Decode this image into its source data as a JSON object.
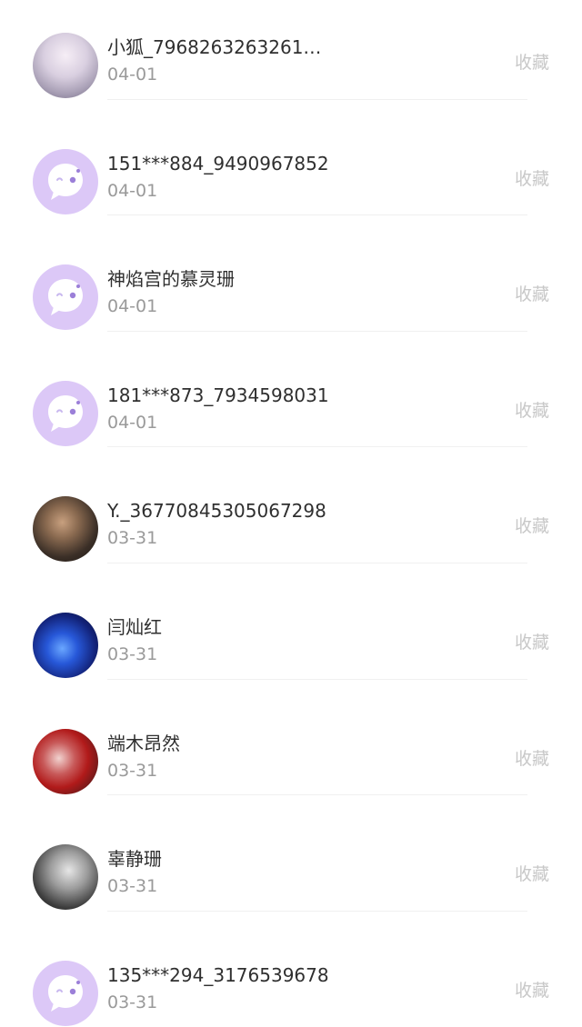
{
  "items": [
    {
      "name": "小狐_7968263263261…",
      "date": "04-01",
      "action": "收藏",
      "avatar": "photo-1"
    },
    {
      "name": "151***884_9490967852",
      "date": "04-01",
      "action": "收藏",
      "avatar": "default"
    },
    {
      "name": "神焰宫的慕灵珊",
      "date": "04-01",
      "action": "收藏",
      "avatar": "default"
    },
    {
      "name": "181***873_7934598031",
      "date": "04-01",
      "action": "收藏",
      "avatar": "default"
    },
    {
      "name": "Y._36770845305067298",
      "date": "03-31",
      "action": "收藏",
      "avatar": "photo-2"
    },
    {
      "name": "闫灿红",
      "date": "03-31",
      "action": "收藏",
      "avatar": "photo-3"
    },
    {
      "name": "端木昂然",
      "date": "03-31",
      "action": "收藏",
      "avatar": "photo-4"
    },
    {
      "name": "辜静珊",
      "date": "03-31",
      "action": "收藏",
      "avatar": "photo-5"
    },
    {
      "name": "135***294_3176539678",
      "date": "03-31",
      "action": "收藏",
      "avatar": "default"
    }
  ],
  "colors": {
    "default_avatar_bg": "#dcc8f7",
    "default_avatar_bubble": "#ffffff",
    "default_avatar_dot": "#9b7fd8"
  },
  "icons": {
    "default_avatar": "chat-bubble-icon"
  }
}
